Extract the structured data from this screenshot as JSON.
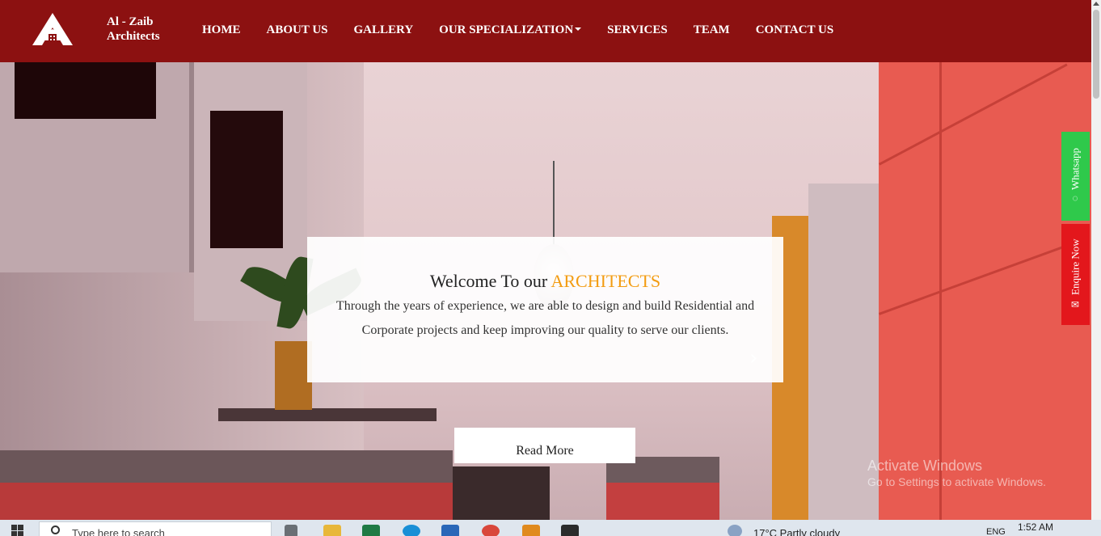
{
  "brand": {
    "line1": "Al - Zaib",
    "line2": "Architects"
  },
  "nav": {
    "home": "HOME",
    "about": "ABOUT US",
    "gallery": "GALLERY",
    "specialization": "OUR SPECIALIZATION",
    "services": "SERVICES",
    "team": "TEAM",
    "contact": "CONTACT US"
  },
  "hero": {
    "title_prefix": "Welcome To our ",
    "title_accent": "ARCHITECTS",
    "text": "Through the years of experience, we are able to design and build Residential and Corporate projects and keep improving our quality to serve our clients.",
    "read_more": "Read More",
    "next_icon": "chevron-right-icon"
  },
  "side_buttons": {
    "whatsapp": "Whatsapp",
    "enquire": "Enquire Now"
  },
  "watermark": {
    "line1": "Activate Windows",
    "line2": "Go to Settings to activate Windows."
  },
  "taskbar": {
    "search_placeholder": "Type here to search",
    "weather": "17°C  Partly cloudy",
    "language": "ENG",
    "time": "1:52 AM"
  },
  "colors": {
    "navbar": "#8c1111",
    "accent": "#f39c12",
    "whatsapp": "#2fc94b",
    "enquire": "#e3171c"
  }
}
